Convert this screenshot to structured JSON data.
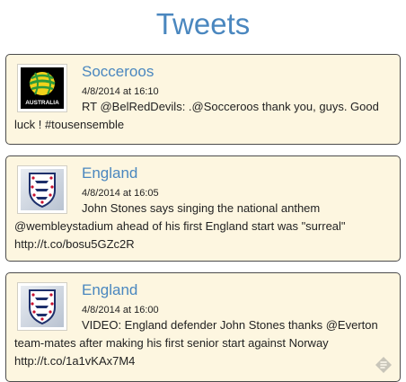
{
  "page": {
    "title": "Tweets"
  },
  "colors": {
    "accent": "#4a87bf",
    "card_background": "#fdf6e0",
    "card_border": "#4c4c4c"
  },
  "tweets": [
    {
      "author": "Socceroos",
      "timestamp": "4/8/2014 at 16:10",
      "text": "RT @BelRedDevils: .@Socceroos thank you, guys. Good luck ! #tousensemble",
      "avatar_icon": "socceroos-crest-icon",
      "avatar_label": "AUSTRALIA"
    },
    {
      "author": "England",
      "timestamp": "4/8/2014 at 16:05",
      "text": "John Stones says singing the national anthem @wembleystadium ahead of his first England start was \"surreal\" http://t.co/bosu5GZc2R",
      "avatar_icon": "england-three-lions-crest-icon"
    },
    {
      "author": "England",
      "timestamp": "4/8/2014 at 16:00",
      "text": "VIDEO: England defender John Stones thanks @Everton team-mates after making his first senior start against Norway http://t.co/1a1vKAx7M4",
      "avatar_icon": "england-three-lions-crest-icon"
    }
  ],
  "widget": {
    "corner_icon": "feed-widget-icon"
  }
}
